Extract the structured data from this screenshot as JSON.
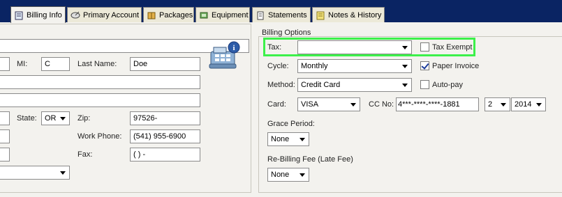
{
  "tabs": [
    {
      "label": "Billing Info",
      "icon": "billing-icon",
      "active": true
    },
    {
      "label": "Primary Account",
      "icon": "satellite-dish-icon",
      "active": false
    },
    {
      "label": "Packages",
      "icon": "package-icon",
      "active": false
    },
    {
      "label": "Equipment",
      "icon": "equipment-icon",
      "active": false
    },
    {
      "label": "Statements",
      "icon": "statement-icon",
      "active": false
    },
    {
      "label": "Notes & History",
      "icon": "notes-icon",
      "active": false
    }
  ],
  "customer": {
    "mi_label": "MI:",
    "mi_value": "C",
    "last_name_label": "Last Name:",
    "last_name_value": "Doe",
    "state_label": "State:",
    "state_value": "OR",
    "zip_label": "Zip:",
    "zip_value": "97526-",
    "work_phone_label": "Work Phone:",
    "work_phone_value": "(541) 955-6900",
    "fax_label": "Fax:",
    "fax_value": "(   )    -"
  },
  "billing": {
    "group_title": "Billing Options",
    "tax_label": "Tax:",
    "tax_value": "",
    "tax_exempt_label": "Tax Exempt",
    "tax_exempt_checked": false,
    "cycle_label": "Cycle:",
    "cycle_value": "Monthly",
    "paper_invoice_label": "Paper Invoice",
    "paper_invoice_checked": true,
    "method_label": "Method:",
    "method_value": "Credit Card",
    "autopay_label": "Auto-pay",
    "autopay_checked": false,
    "card_label": "Card:",
    "card_value": "VISA",
    "cc_no_label": "CC No:",
    "cc_no_value": "4***-****-****-1881",
    "exp_month": "2",
    "exp_year": "2014",
    "grace_label": "Grace Period:",
    "grace_value": "None",
    "rebill_label": "Re-Billing Fee (Late Fee)",
    "rebill_value": "None"
  },
  "colors": {
    "titlebar": "#0a2463",
    "highlight": "#3cf04a"
  }
}
